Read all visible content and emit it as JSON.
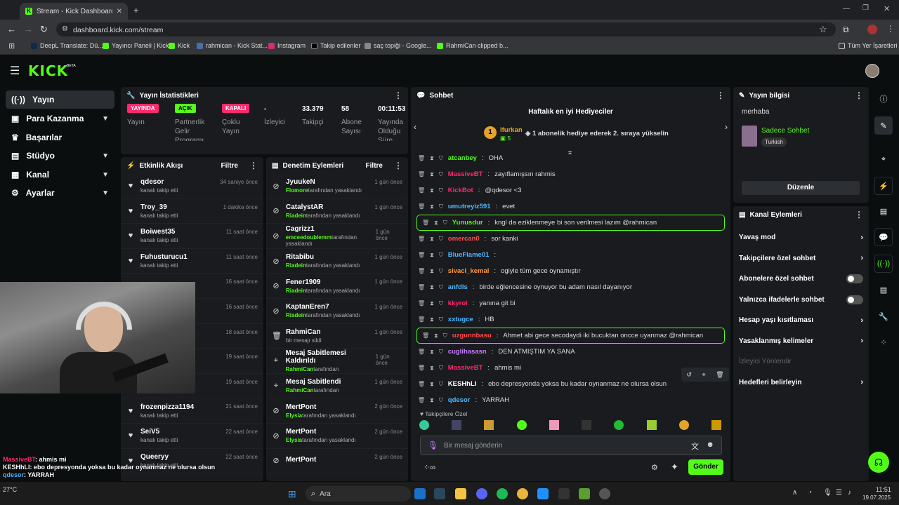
{
  "browser": {
    "tab_title": "Stream - Kick Dashboard",
    "url": "dashboard.kick.com/stream",
    "bookmarks": [
      "DeepL Translate: Dü...",
      "Yayıncı Paneli | Kick",
      "Kick",
      "rahmican - Kick Stat...",
      "Instagram",
      "Takip edilenler",
      "saç topiği - Google...",
      "RahmiCan clipped b..."
    ],
    "other_bookmarks": "Tüm Yer İşaretleri"
  },
  "app": {
    "logo": "KICK",
    "logo_sup": "BETA"
  },
  "sidebar": {
    "items": [
      {
        "label": "Yayın"
      },
      {
        "label": "Para Kazanma"
      },
      {
        "label": "Başarılar"
      },
      {
        "label": "Stüdyo"
      },
      {
        "label": "Kanal"
      },
      {
        "label": "Ayarlar"
      }
    ]
  },
  "stats": {
    "title": "Yayın İstatistikleri",
    "items": [
      {
        "value": "YAYINDA",
        "label": "Yayın",
        "color": "#ff2a6d"
      },
      {
        "value": "AÇIK",
        "label": "Partnerlik Gelir Programı",
        "color": "#53fc18"
      },
      {
        "value": "KAPALI",
        "label": "Çoklu Yayın",
        "color": "#ff2a6d"
      },
      {
        "value": "-",
        "label": "İzleyici"
      },
      {
        "value": "33.379",
        "label": "Takipçi"
      },
      {
        "value": "58",
        "label": "Abone Sayısı"
      },
      {
        "value": "00:11:53",
        "label": "Yayında Olduğu Süre"
      }
    ]
  },
  "activity": {
    "title": "Etkinlik Akışı",
    "filter": "Filtre",
    "items": [
      {
        "name": "qdesor",
        "sub": "kanalı takip etti",
        "time": "34 saniye önce"
      },
      {
        "name": "Troy_39",
        "sub": "kanalı takip etti",
        "time": "1 dakika önce"
      },
      {
        "name": "Boiwest35",
        "sub": "kanalı takip etti",
        "time": "11 saat önce"
      },
      {
        "name": "Fuhusturucu1",
        "sub": "kanalı takip etti",
        "time": "11 saat önce"
      },
      {
        "name": "",
        "sub": "",
        "time": "16 saat önce"
      },
      {
        "name": "",
        "sub": "",
        "time": "16 saat önce"
      },
      {
        "name": "",
        "sub": "",
        "time": "18 saat önce"
      },
      {
        "name": "",
        "sub": "",
        "time": "19 saat önce"
      },
      {
        "name": "",
        "sub": "",
        "time": "19 saat önce"
      },
      {
        "name": "frozenpizza1194",
        "sub": "kanalı takip etti",
        "time": "21 saat önce"
      },
      {
        "name": "SeiV5",
        "sub": "kanalı takip etti",
        "time": "22 saat önce"
      },
      {
        "name": "Queeryy",
        "sub": "kanalı takip etti",
        "time": "22 saat önce"
      }
    ]
  },
  "moderation": {
    "title": "Denetim Eylemleri",
    "filter": "Filtre",
    "items": [
      {
        "name": "JyuukeN",
        "actor": "Flomore",
        "sub": "tarafından yasaklandı",
        "time": "1 gün önce",
        "icon": "⊘"
      },
      {
        "name": "CatalystAR",
        "actor": "Riadein",
        "sub": "tarafından yasaklandı",
        "time": "1 gün önce",
        "icon": "⊘"
      },
      {
        "name": "Cagrizz1",
        "actor": "emceedoublemm",
        "sub": "tarafından yasaklandı",
        "time": "1 gün önce",
        "icon": "⊘"
      },
      {
        "name": "Ritabibu",
        "actor": "Riadein",
        "sub": "tarafından yasaklandı",
        "time": "1 gün önce",
        "icon": "⊘"
      },
      {
        "name": "Fener1909",
        "actor": "Riadein",
        "sub": "tarafından yasaklandı",
        "time": "1 gün önce",
        "icon": "⊘"
      },
      {
        "name": "KaptanEren7",
        "actor": "Riadein",
        "sub": "tarafından yasaklandı",
        "time": "1 gün önce",
        "icon": "⊘"
      },
      {
        "name": "RahmiCan",
        "actor": "",
        "sub": "bir mesajı sildi",
        "time": "1 gün önce",
        "icon": "🗑"
      },
      {
        "name": "Mesaj Sabitlemesi Kaldırıldı",
        "actor": "RahmiCan",
        "sub": "tarafından",
        "time": "1 gün önce",
        "icon": "⌖"
      },
      {
        "name": "Mesaj Sabitlendi",
        "actor": "RahmiCan",
        "sub": "tarafından",
        "time": "1 gün önce",
        "icon": "⌖"
      },
      {
        "name": "MertPont",
        "actor": "Elysia",
        "sub": "tarafından yasaklandı",
        "time": "2 gün önce",
        "icon": "⊘"
      },
      {
        "name": "MertPont",
        "actor": "Elysia",
        "sub": "tarafından yasaklandı",
        "time": "2 gün önce",
        "icon": "⊘"
      },
      {
        "name": "MertPont",
        "actor": "",
        "sub": "",
        "time": "2 gün önce",
        "icon": "⊘"
      }
    ]
  },
  "chat": {
    "title": "Sohbet",
    "gifters_title": "Haftalık en iyi Hediyeciler",
    "gifter_rank": "1",
    "gifter_name": "Ifurkan",
    "gifter_count": "5",
    "gifter_note": "1 abonelik hediye ederek 2. sıraya yükselin",
    "messages": [
      {
        "user": "atcanbey",
        "text": "OHA",
        "color": "#53fc18",
        "hl": false
      },
      {
        "user": "MassiveBT",
        "text": "zayıflamışsın rahmis",
        "color": "#ff2a6d",
        "hl": false
      },
      {
        "user": "KickBot",
        "text": "@qdesor <3",
        "color": "#ff2a6d",
        "hl": false
      },
      {
        "user": "umutreyiz591",
        "text": "evet",
        "color": "#4db8ff",
        "hl": false
      },
      {
        "user": "Yunusdur",
        "text": "kngl da eziklenmeye bi son verilmesi lazım @rahmican",
        "color": "#53fc18",
        "hl": true
      },
      {
        "user": "omercan0",
        "text": "sor kanki",
        "color": "#ff4d4d",
        "hl": false
      },
      {
        "user": "BlueFlame01",
        "text": "",
        "color": "#4db8ff",
        "hl": false
      },
      {
        "user": "sivaci_kemal",
        "text": "ogiyle tüm gece oynamıştır",
        "color": "#ff9a3d",
        "hl": false
      },
      {
        "user": "anfdls",
        "text": "birde eğlencesine oynuyor bu adam nasıl dayanıyor",
        "color": "#4db8ff",
        "hl": false
      },
      {
        "user": "kkyroi",
        "text": "yanına git bi",
        "color": "#ff2a6d",
        "hl": false
      },
      {
        "user": "xxtugce",
        "text": "HB",
        "color": "#4db8ff",
        "hl": false
      },
      {
        "user": "uzgunnbasu",
        "text": "Ahmet abi gece secodaydi iki bucuktan oncce uyanmaz @rahmican",
        "color": "#ff4d4d",
        "hl": true
      },
      {
        "user": "cuglihasasn",
        "text": "DEN ATMIŞTIM YA SANA",
        "color": "#c77dff",
        "hl": false
      },
      {
        "user": "MassiveBT",
        "text": "ahmis mi",
        "color": "#ff2a6d",
        "hl": false
      },
      {
        "user": "KESHhLI",
        "text": "ebo depresyonda yoksa bu kadar oynanmaz ne olursa olsun",
        "color": "#ffffff",
        "hl": false
      },
      {
        "user": "qdesor",
        "text": "YARRAH",
        "color": "#4db8ff",
        "hl": false
      }
    ],
    "followers_only": "Takipçilere Özel",
    "input_placeholder": "Bir mesaj gönderin",
    "send": "Gönder"
  },
  "stream_info": {
    "title": "Yayın bilgisi",
    "stream_title": "merhaba",
    "category": "Sadece Sohbet",
    "tag": "Turkish",
    "edit": "Düzenle"
  },
  "channel_actions": {
    "title": "Kanal Eylemleri",
    "items": [
      {
        "label": "Yavaş mod",
        "type": "chevron"
      },
      {
        "label": "Takipçilere özel sohbet",
        "type": "chevron"
      },
      {
        "label": "Abonelere özel sohbet",
        "type": "toggle"
      },
      {
        "label": "Yalnızca ifadelerle sohbet",
        "type": "toggle"
      },
      {
        "label": "Hesap yaşı kısıtlaması",
        "type": "chevron"
      },
      {
        "label": "Yasaklanmış kelimeler",
        "type": "chevron"
      },
      {
        "label": "İzleyici Yönlendir",
        "type": "disabled"
      },
      {
        "label": "Hedefleri belirleyin",
        "type": "chevron"
      }
    ]
  },
  "overlay_chat": [
    {
      "user": "MassiveBT",
      "text": "ahmis mi",
      "color": "#ff2a6d"
    },
    {
      "user": "KESHhLI",
      "text": "ebo depresyonda yoksa bu kadar oynanmaz ne olursa olsun",
      "color": "#ffffff"
    },
    {
      "user": "qdesor",
      "text": "YARRAH",
      "color": "#4db8ff"
    }
  ],
  "taskbar": {
    "search": "Ara",
    "time": "11:51",
    "date": "19.07.2025",
    "weather": "27°C"
  }
}
